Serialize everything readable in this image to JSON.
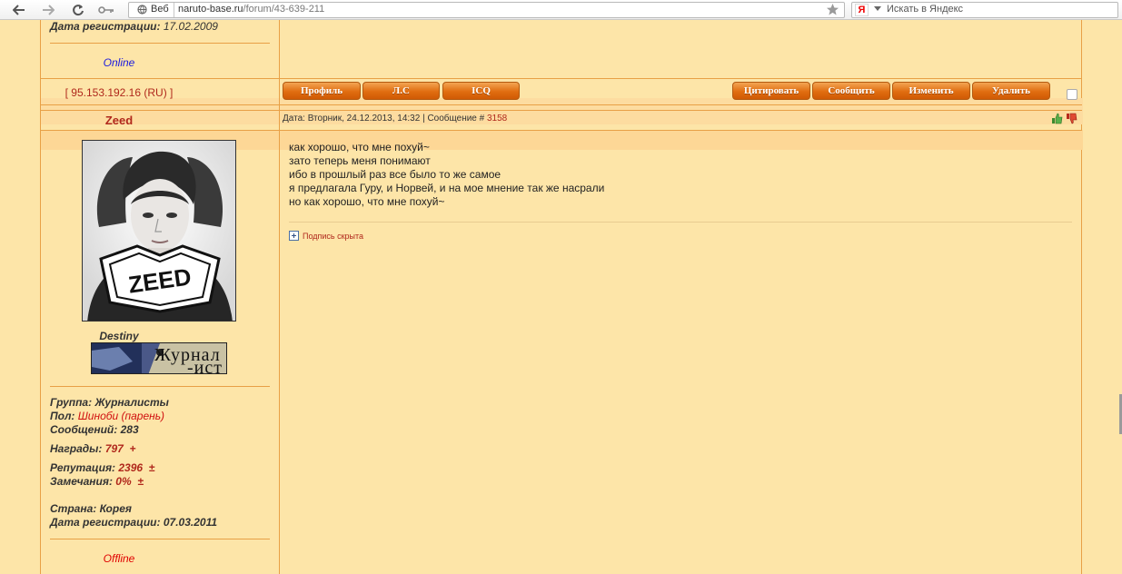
{
  "browser": {
    "web_label": "Веб",
    "url_host": "naruto-base.ru",
    "url_path": "/forum/43-639-211",
    "search_engine_badge": "Я",
    "search_placeholder": "Искать в Яндекс",
    "icons": [
      "back-arrow-icon",
      "forward-arrow-icon",
      "reload-icon",
      "key-icon",
      "globe-icon",
      "bookmark-star-icon",
      "dropdown-arrow-icon"
    ]
  },
  "previous_post": {
    "reg_label": "Дата регистрации:",
    "reg_date": "17.02.2009",
    "status": "Online",
    "ip": "[ 95.153.192.16 (RU) ]"
  },
  "actions": {
    "left": [
      "Профиль",
      "Л.С",
      "ICQ"
    ],
    "right": [
      "Цитировать",
      "Сообщить",
      "Изменить",
      "Удалить"
    ]
  },
  "post": {
    "author": "Zeed",
    "date_text": "Дата: Вторник, 24.12.2013, 14:32 | Сообщение #",
    "number": "3158",
    "icons": [
      "thumbs-up-icon",
      "thumbs-down-icon"
    ],
    "message": [
      "как хорошо, что мне похуй~",
      "зато теперь меня понимают",
      "ибо в прошлый раз все было то же самое",
      "я предлагала Гуру, и Норвей, и на мое мнение так же насрали",
      "но как хорошо, что мне похуй~"
    ],
    "signature_toggle": "Подпись скрыта"
  },
  "profile": {
    "avatar_text": "ZEED",
    "rank": "Destiny",
    "userbar_text": "Журнал\n      -ист",
    "group_label": "Группа:",
    "group": "Журналисты",
    "gender_label": "Пол:",
    "gender": "Шиноби (парень)",
    "posts_label": "Сообщений:",
    "posts": "283",
    "awards_label": "Награды:",
    "awards": "797",
    "awards_action": "+",
    "reputation_label": "Репутация:",
    "reputation": "2396",
    "reputation_action": "±",
    "warnings_label": "Замечания:",
    "warnings": "0%",
    "warnings_action": "±",
    "country_label": "Страна:",
    "country": "Корея",
    "reg_label": "Дата регистрации:",
    "reg_date": "07.03.2011",
    "status": "Offline"
  },
  "colors": {
    "background": "#fde5a8",
    "border": "#e8a046",
    "button": "#e06d10",
    "link_red": "#b0281c",
    "online": "#1a1adf",
    "offline": "#e00000"
  }
}
